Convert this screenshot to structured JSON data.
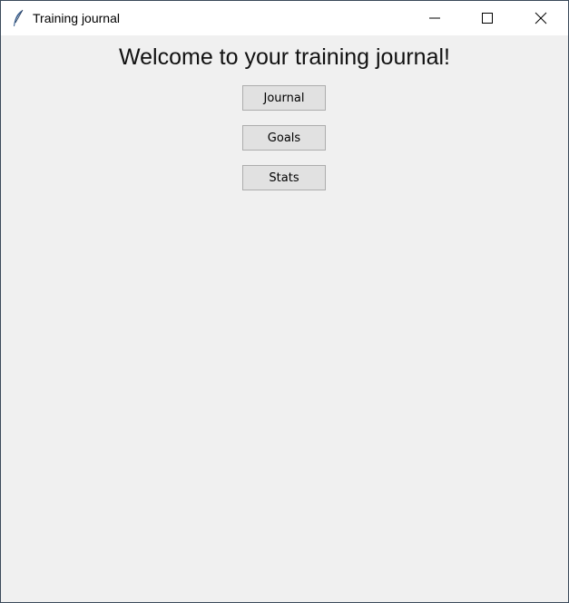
{
  "window": {
    "title": "Training journal",
    "app_icon": "feather-icon",
    "controls": {
      "minimize": "minimize-icon",
      "maximize": "maximize-icon",
      "close": "close-icon"
    }
  },
  "main": {
    "heading": "Welcome to your training journal!",
    "buttons": [
      {
        "label": "Journal"
      },
      {
        "label": "Goals"
      },
      {
        "label": "Stats"
      }
    ]
  },
  "colors": {
    "background": "#f0f0f0",
    "titlebar": "#ffffff",
    "button_face": "#e1e1e1",
    "button_border": "#adadad"
  }
}
